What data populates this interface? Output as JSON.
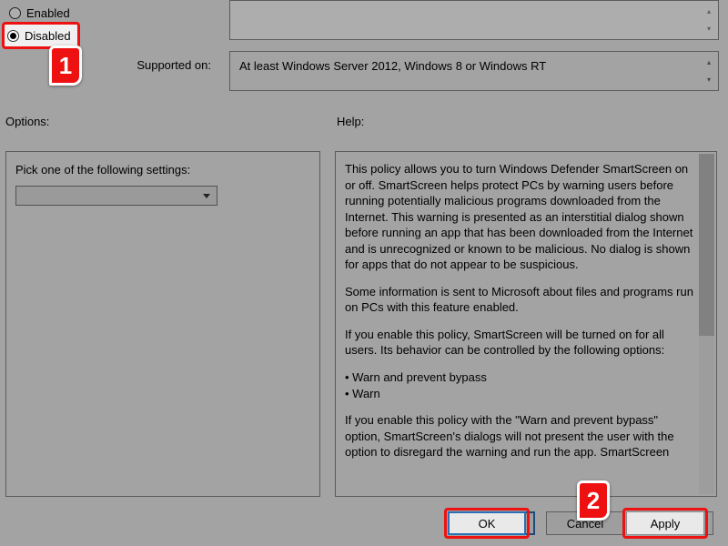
{
  "radios": {
    "enabled_label": "Enabled",
    "disabled_label": "Disabled",
    "selected": "disabled"
  },
  "supported": {
    "label": "Supported on:",
    "value": "At least Windows Server 2012, Windows 8 or Windows RT"
  },
  "sections": {
    "options_label": "Options:",
    "help_label": "Help:"
  },
  "options": {
    "prompt": "Pick one of the following settings:"
  },
  "help": {
    "p1": "This policy allows you to turn Windows Defender SmartScreen on or off.  SmartScreen helps protect PCs by warning users before running potentially malicious programs downloaded from the Internet.  This warning is presented as an interstitial dialog shown before running an app that has been downloaded from the Internet and is unrecognized or known to be malicious.  No dialog is shown for apps that do not appear to be suspicious.",
    "p2": "Some information is sent to Microsoft about files and programs run on PCs with this feature enabled.",
    "p3": "If you enable this policy, SmartScreen will be turned on for all users.  Its behavior can be controlled by the following options:",
    "b1": "• Warn and prevent bypass",
    "b2": "• Warn",
    "p4": "If you enable this policy with the \"Warn and prevent bypass\" option, SmartScreen's dialogs will not present the user with the option to disregard the warning and run the app.  SmartScreen"
  },
  "buttons": {
    "ok": "OK",
    "cancel": "Cancel",
    "apply": "Apply"
  },
  "annotations": {
    "step1": "1",
    "step2": "2"
  }
}
